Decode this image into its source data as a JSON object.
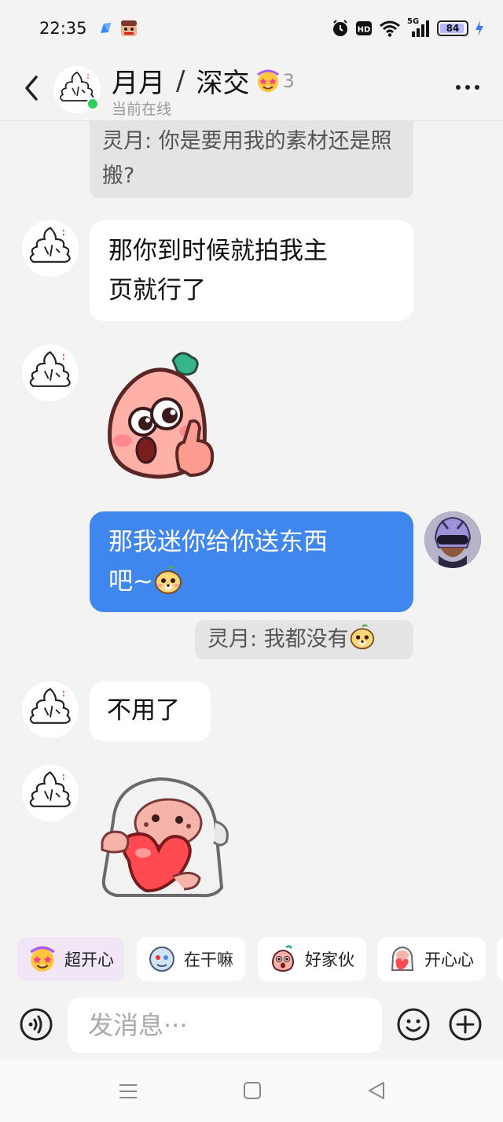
{
  "status_bar": {
    "time": "22:35",
    "network": "5G",
    "battery": "84",
    "icons": [
      "app-notification-icon",
      "game-notification-icon",
      "alarm-icon",
      "hd-icon",
      "wifi-icon",
      "signal-icon",
      "battery-icon",
      "charging-icon"
    ]
  },
  "header": {
    "name": "月月",
    "separator": "/",
    "relation": "深交",
    "intimacy_level": "3",
    "status": "当前在线",
    "icons": [
      "back-icon",
      "more-icon"
    ]
  },
  "messages": [
    {
      "type": "quote",
      "text": "灵月: 你是要用我的素材还是照搬?"
    },
    {
      "type": "text",
      "side": "in",
      "line1": "那你到时候就拍我主",
      "line2": "页就行了"
    },
    {
      "type": "sticker",
      "side": "in",
      "sticker": "peach-thumbs-up-sticker"
    },
    {
      "type": "text",
      "side": "out",
      "line1": "那我迷你给你送东西",
      "line2": "吧~",
      "emoji": "dog-face-emoji"
    },
    {
      "type": "quote",
      "text": "灵月: 我都没有",
      "emoji": "dog-face-emoji"
    },
    {
      "type": "text",
      "side": "in",
      "line1": "不用了"
    },
    {
      "type": "sticker",
      "side": "in",
      "sticker": "sheep-heart-sticker"
    }
  ],
  "quick_reactions": [
    {
      "label": "超开心",
      "icon": "star-eyes-icon"
    },
    {
      "label": "在干嘛",
      "icon": "doll-icon"
    },
    {
      "label": "好家伙",
      "icon": "peach-face-icon"
    },
    {
      "label": "开心心",
      "icon": "heart-hug-icon"
    }
  ],
  "input": {
    "placeholder": "发消息···",
    "icons": [
      "voice-icon",
      "emoji-icon",
      "plus-icon"
    ]
  },
  "colors": {
    "background": "#f3f3f3",
    "outgoing_bubble": "#3f86ef",
    "incoming_bubble": "#ffffff",
    "online": "#2fcf5c"
  }
}
